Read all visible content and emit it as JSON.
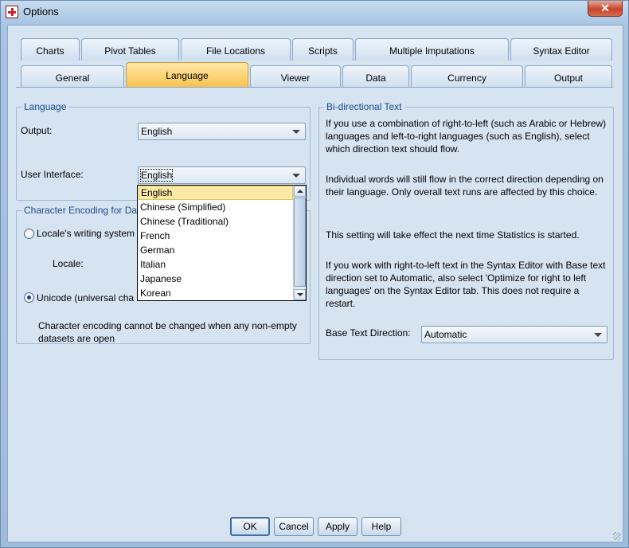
{
  "window": {
    "title": "Options",
    "close_label": "✕"
  },
  "tabs_row1": [
    {
      "label": "Charts"
    },
    {
      "label": "Pivot Tables"
    },
    {
      "label": "File Locations"
    },
    {
      "label": "Scripts"
    },
    {
      "label": "Multiple Imputations"
    },
    {
      "label": "Syntax Editor"
    }
  ],
  "tabs_row2": [
    {
      "label": "General"
    },
    {
      "label": "Language",
      "active": true
    },
    {
      "label": "Viewer"
    },
    {
      "label": "Data"
    },
    {
      "label": "Currency"
    },
    {
      "label": "Output"
    }
  ],
  "language_group": {
    "title": "Language",
    "output_label": "Output:",
    "output_value": "English",
    "ui_label": "User Interface:",
    "ui_value": "English",
    "ui_options": [
      "English",
      "Chinese (Simplified)",
      "Chinese (Traditional)",
      "French",
      "German",
      "Italian",
      "Japanese",
      "Korean"
    ],
    "ui_selected": "English"
  },
  "encoding_group": {
    "title": "Character Encoding for Da",
    "locale_radio_label": "Locale's writing system",
    "locale_label": "Locale:",
    "unicode_radio_label": "Unicode (universal cha",
    "selected": "unicode",
    "note": "Character encoding cannot be changed when any non-empty datasets are open"
  },
  "bidi_group": {
    "title": "Bi-directional Text",
    "para1": "If you use a combination of right-to-left (such as Arabic or Hebrew) languages and left-to-right languages (such as English), select which direction text should flow.",
    "para2": "Individual words will still flow in the correct direction depending on their language. Only overall text runs are affected by this choice.",
    "para3": "This setting will take effect the next time Statistics is started.",
    "para4": "If you work with right-to-left text in the Syntax Editor with Base text direction set to Automatic, also select 'Optimize for right to left languages' on the Syntax Editor tab. This does not require a restart.",
    "base_label": "Base Text Direction:",
    "base_value": "Automatic"
  },
  "buttons": {
    "ok": "OK",
    "cancel": "Cancel",
    "apply": "Apply",
    "help": "Help"
  },
  "colors": {
    "active_tab": "#f8c24c",
    "selection": "#fbe9a6",
    "group_title": "#1a4a8a"
  }
}
